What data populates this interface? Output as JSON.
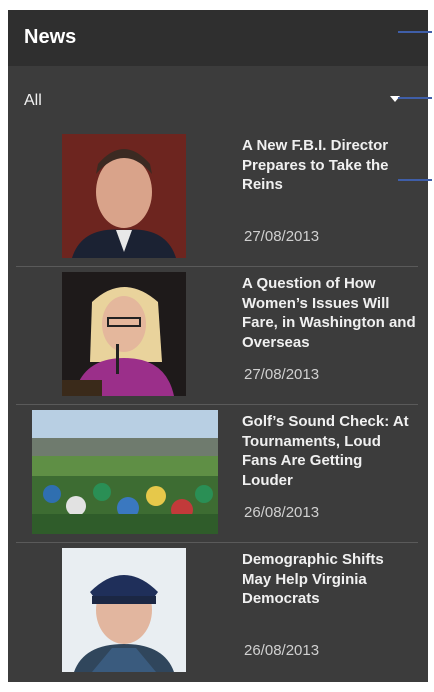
{
  "header": {
    "title": "News"
  },
  "filter": {
    "selected": "All"
  },
  "articles": [
    {
      "headline": "A New F.B.I. Director Prepares to Take the Reins",
      "date": "27/08/2013",
      "image": "man-in-suit-portrait"
    },
    {
      "headline": "A Question of How Women’s Issues Will Fare, in Washington and Overseas",
      "date": "27/08/2013",
      "image": "woman-speaking-at-hearing"
    },
    {
      "headline": "Golf’s Sound Check: At Tournaments, Loud Fans Are Getting Louder",
      "date": "26/08/2013",
      "image": "golf-crowd-cheering"
    },
    {
      "headline": "Demographic Shifts May Help Virginia Democrats",
      "date": "26/08/2013",
      "image": "man-in-cap-portrait"
    }
  ]
}
